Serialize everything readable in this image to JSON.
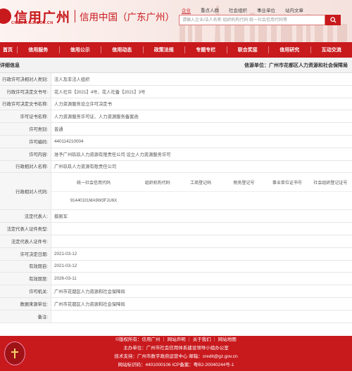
{
  "header": {
    "brand_name": "信用广州",
    "brand_sub": "信用中国（广东广州）",
    "brand_url": "CREDIT.GZ.GOV.CN",
    "search_tabs": [
      "企业",
      "重点人群",
      "社会组织",
      "事业单位",
      "站内文章"
    ],
    "search_placeholder": "请输入企业/法人名称  组织机构代码 统一社会信用代码等"
  },
  "nav": [
    "首页",
    "信用服务",
    "信用公示",
    "信用动态",
    "政策法规",
    "专题专栏",
    "联合奖惩",
    "信用研究",
    "互动交流"
  ],
  "section": {
    "title": "详细信息",
    "source": "信源单位：广州市花都区人力资源和社会保障局"
  },
  "rows": [
    {
      "label": "行政许可决相对人类别:",
      "value": "法人及非法人组织"
    },
    {
      "label": "行政许可决定文书号:",
      "value": "花人社许【2021】4号、花人社备【2021】3号"
    },
    {
      "label": "行政许可决定文书名称:",
      "value": "人力资源服务设立许可决定书"
    },
    {
      "label": "许可证书名称:",
      "value": "人力资源服务许可证、人力资源服务备案函"
    },
    {
      "label": "许可类别:",
      "value": "普通"
    },
    {
      "label": "许可编码:",
      "value": "440114210004"
    },
    {
      "label": "许可内容:",
      "value": "准予广州玖玖人力资源有限责任公司 设立人力资源服务许可"
    },
    {
      "label": "行政相对人名称:",
      "value": "广州玖玖人力资源有限责任公司"
    }
  ],
  "codes": {
    "label": "行政相对人代码:",
    "headers": [
      "统一社会信用代码",
      "组织机构代码",
      "工商登记码",
      "税务登记号",
      "事业单位证书号",
      "社会组织登记证号"
    ],
    "values": [
      "91440101MA9W3FJU6X",
      "",
      "",
      "",
      "",
      ""
    ]
  },
  "rows2": [
    {
      "label": "法定代表人:",
      "value": "蔡刚军"
    },
    {
      "label": "法定代表人证件类型:",
      "value": ""
    },
    {
      "label": "法定代表人证件号:",
      "value": ""
    },
    {
      "label": "许可决定日期:",
      "value": "2021-03-12"
    },
    {
      "label": "有效期自:",
      "value": "2021-03-12"
    },
    {
      "label": "有效期至:",
      "value": "2026-03-11"
    },
    {
      "label": "许可机关:",
      "value": "广州市花都区人力资源和社会保障局"
    },
    {
      "label": "数据来源单位:",
      "value": "广州市花都区人力资源和社会保障局"
    },
    {
      "label": "备注:",
      "value": ""
    }
  ],
  "footer": {
    "line1": "©版权所有：信用广州 ｜ 网站声明 ｜ 关于我们 ｜ 网站地图",
    "line2": "主办单位：广州市社会信用体系建设领导小组办公室",
    "line3": "技术支持：广州市数字政府运营中心    邮箱：credit@gz.gov.cn",
    "line4": "网站标识码：4401000106    ICP备案：粤B2-20040244号-1"
  },
  "colors": {
    "brand": "#c8191d",
    "label_bg": "#f6f6f6"
  }
}
